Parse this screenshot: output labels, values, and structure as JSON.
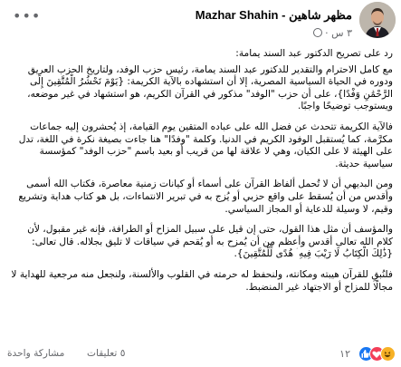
{
  "post": {
    "author": "Mazhar Shahin - مظهر شاهين",
    "timestamp": "٣ س",
    "paragraphs": [
      "رد على تصريح الدكتور عبد السند يمامة:",
      "مع كامل الاحترام والتقدير للدكتور عبد السند يمامة، رئيس حزب الوفد، ولتاريخ الحزب العريق ودوره في الحياة السياسية المصرية، إلا أن استشهاده بالآية الكريمة: {يَوْمَ نَحْشُرُ الْمُتَّقِينَ إِلَى الرَّحْمَٰنِ وَفْدًا}، على أن حزب \"الوفد\" مذكور في القرآن الكريم، هو استشهاد في غير موضعه، ويستوجب توضيحًا واجبًا.",
      "فالآية الكريمة تتحدث عن فضل الله على عباده المتقين يوم القيامة، إذ يُحشرون إليه جماعات مكرَّمة، كما يُستقبل الوفود الكريم في الدنيا. وكلمة \"وفدًا\" هنا جاءت بصيغة نكرة في اللغة، تدل على الهيئة لا على الكيان، وهي لا علاقة لها من قريب أو بعيد باسم \"حزب الوفد\" كمؤسسة سياسية حديثة.",
      "ومن البديهي أن لا تُحمل ألفاظ القرآن على أسماء أو كيانات زمنية معاصرة، فكتاب الله أسمى وأقدس من أن يُسقط على واقع حزبي أو يُزج به في تبرير الانتماءات، بل هو كتاب هداية وتشريع وقيم، لا وسيلة للدعاية أو المجاز السياسي.",
      "والمؤسف أن مثل هذا القول، حتى إن قيل على سبيل المزاح أو الطرافة، فإنه غير مقبول، لأن كلام الله تعالى أقدس وأعظم من أن يُمزح به أو يُقحم في سياقات لا تليق بجلاله. قال تعالى: {ذَٰلِكَ الْكِتَابُ لَا رَيْبَ فِيهِ ۛ هُدًى لِّلْمُتَّقِينَ}.",
      "فلنُبقِ للقرآن هيبته ومكانته، ولنحفظ له حرمته في القلوب والألسنة، ولنجعل منه مرجعية للهداية لا مجالًا للمزاح أو الاجتهاد غير المنضبط."
    ]
  },
  "engagement": {
    "reaction_count": "١٢",
    "comments": "٥ تعليقات",
    "shares": "مشاركة واحدة"
  },
  "colors": {
    "text": "#050505",
    "muted": "#65676b",
    "like": "#1877f2",
    "love": "#f33e58",
    "haha": "#f7b125"
  },
  "icons": [
    "more-icon",
    "globe-icon",
    "like-reaction-icon",
    "love-reaction-icon",
    "haha-reaction-icon"
  ]
}
